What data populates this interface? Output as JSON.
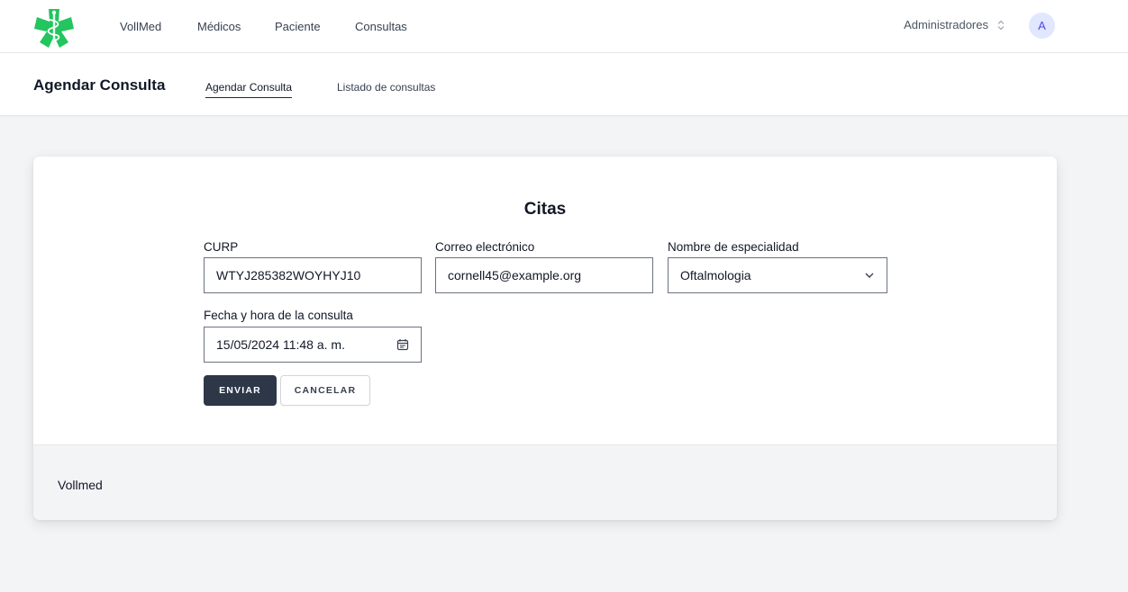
{
  "header": {
    "brand": "VollMed",
    "nav": [
      "Médicos",
      "Paciente",
      "Consultas"
    ],
    "user_role": "Administradores",
    "avatar_initial": "A"
  },
  "subheader": {
    "title": "Agendar Consulta",
    "tabs": [
      "Agendar Consulta",
      "Listado de consultas"
    ],
    "active_tab": "Agendar Consulta"
  },
  "form": {
    "title": "Citas",
    "curp": {
      "label": "CURP",
      "value": "WTYJ285382WOYHYJ10"
    },
    "email": {
      "label": "Correo electrónico",
      "value": "cornell45@example.org"
    },
    "specialty": {
      "label": "Nombre de especialidad",
      "value": "Oftalmologia"
    },
    "datetime": {
      "label": "Fecha y hora de la consulta",
      "value": "15/05/2024 11:48 a. m."
    },
    "submit_label": "ENVIAR",
    "cancel_label": "CANCELAR"
  },
  "footer": {
    "text": "Vollmed"
  },
  "colors": {
    "primary_button": "#2d3748",
    "logo_green": "#22c55e",
    "avatar_bg": "#e0e7ff"
  },
  "icons": [
    "medical-logo-icon",
    "sort-icon",
    "chevron-down-icon",
    "calendar-icon"
  ]
}
